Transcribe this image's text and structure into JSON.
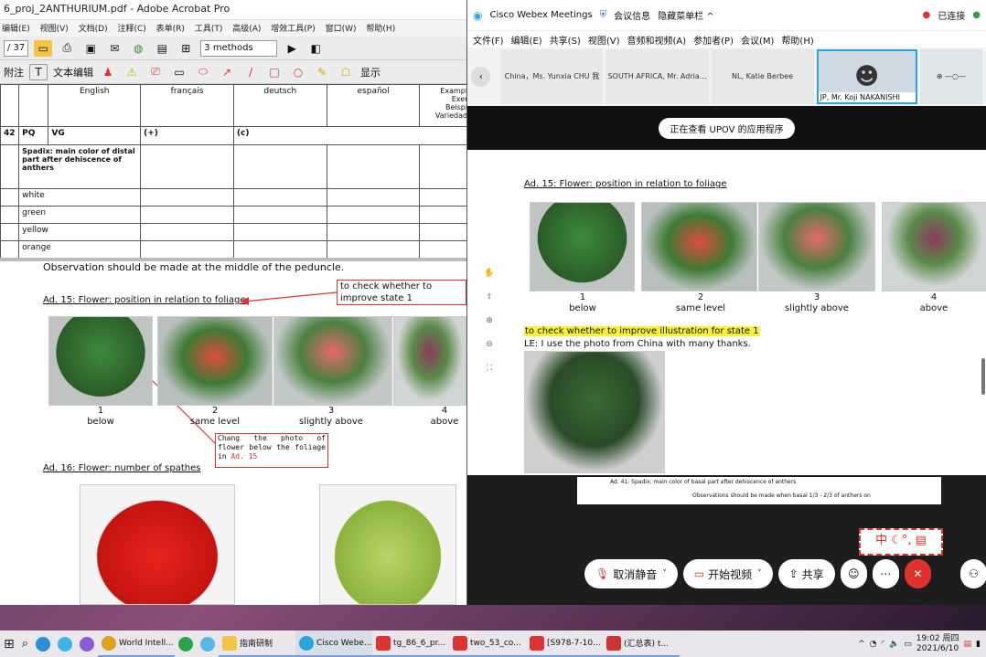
{
  "acrobat": {
    "title": "6_proj_2ANTHURIUM.pdf - Adobe Acrobat Pro",
    "menu": [
      "编辑(E)",
      "视图(V)",
      "文档(D)",
      "注释(C)",
      "表单(R)",
      "工具(T)",
      "高级(A)",
      "增效工具(P)",
      "窗口(W)",
      "帮助(H)"
    ],
    "page_of": "/ 37",
    "combo_value": "3 methods",
    "tb2_attach": "附注",
    "tb2_textedit": "文本编辑",
    "tb2_display": "显示",
    "table": {
      "headers": [
        "English",
        "français",
        "deutsch",
        "español",
        "Example Exem Beispie Variedade"
      ],
      "row_num": "42",
      "pq": "PQ",
      "vg": "VG",
      "plus": "(+)",
      "c": "(c)",
      "char_title": "Spadix: main color of distal part after dehiscence of anthers",
      "colors": [
        "white",
        "green",
        "yellow",
        "orange"
      ]
    },
    "observation": "Observation should be made at the middle of the peduncle.",
    "ad15_title": "Ad. 15: Flower: position in relation to foliage",
    "note1": "to check whether to improve state 1",
    "note2_text": "Chang the photo of flower below the foliage in",
    "note2_ref": "Ad. 15",
    "captions": [
      {
        "num": "1",
        "label": "below"
      },
      {
        "num": "2",
        "label": "same level"
      },
      {
        "num": "3",
        "label": "slightly above"
      },
      {
        "num": "4",
        "label": "above"
      }
    ],
    "ad16_title": "Ad. 16: Flower: number of spathes"
  },
  "webex": {
    "app_name": "Cisco Webex Meetings",
    "meeting_info": "会议信息",
    "hide_menu": "隐藏菜单栏 ^",
    "connected": "已连接",
    "menu": [
      "文件(F)",
      "编辑(E)",
      "共享(S)",
      "视图(V)",
      "音频和视频(A)",
      "参加者(P)",
      "会议(M)",
      "帮助(H)"
    ],
    "participants": [
      "China，Ms. Yunxia CHU 我",
      "SOUTH AFRICA, Mr. Adria...",
      "NL, Katie Berbee",
      "JP, Mr. Koji NAKANISHI"
    ],
    "sharing_label": "正在查看 UPOV 的应用程序",
    "ad15_title": "Ad. 15: Flower: position in relation to foliage",
    "highlight": "to check whether to improve illustration for state 1",
    "le_note": "LE: I use the photo from China with many thanks.",
    "small_title": "Ad. 41: Spadix: main color of basal part after dehiscence of anthers",
    "small_obs": "Observations should be made when basal 1/3 - 2/3 of anthers on",
    "ime": "中",
    "controls": {
      "unmute": "取消静音",
      "start_video": "开始视频",
      "share": "共享"
    }
  },
  "taskbar": {
    "apps": [
      "World Intell...",
      "指南研制",
      "Cisco Webe...",
      "tg_86_6_pr...",
      "two_53_co...",
      "[S978-7-10...",
      "(汇总表) t..."
    ],
    "time": "19:02 周四",
    "date": "2021/6/10"
  },
  "colors": {
    "annotation_red": "#d33333",
    "highlight_yellow": "#f5f232",
    "webex_end": "#e0322d",
    "webex_video_border": "#2aa4de"
  }
}
